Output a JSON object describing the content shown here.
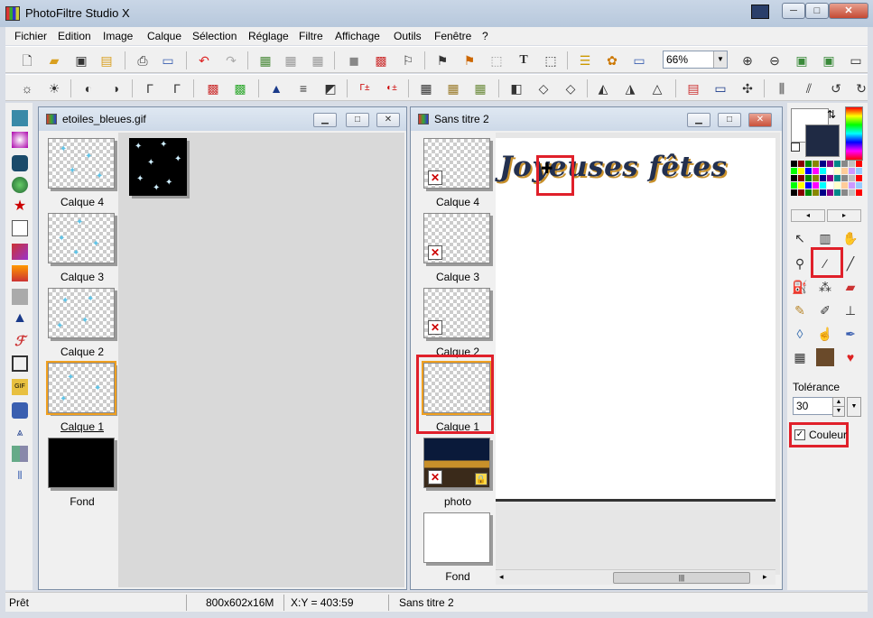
{
  "window": {
    "title": "PhotoFiltre Studio X",
    "controls": {
      "minimize": "─",
      "maximize": "□",
      "close": "✕"
    }
  },
  "menu": [
    "Fichier",
    "Edition",
    "Image",
    "Calque",
    "Sélection",
    "Réglage",
    "Filtre",
    "Affichage",
    "Outils",
    "Fenêtre",
    "?"
  ],
  "toolbar": {
    "zoom_value": "66%",
    "text_tool_glyph": "T"
  },
  "doc_left": {
    "title": "etoiles_bleues.gif",
    "layers": [
      {
        "label": "Calque 4"
      },
      {
        "label": "Calque 3"
      },
      {
        "label": "Calque 2"
      },
      {
        "label": "Calque 1",
        "selected": true
      },
      {
        "label": "Fond"
      }
    ]
  },
  "doc_right": {
    "title": "Sans titre 2",
    "canvas_text": "Joyeuses fêtes",
    "layers": [
      {
        "label": "Calque 4"
      },
      {
        "label": "Calque 3"
      },
      {
        "label": "Calque 2"
      },
      {
        "label": "Calque 1",
        "selected": true
      },
      {
        "label": "photo",
        "locked": true
      },
      {
        "label": "Fond"
      }
    ],
    "scroll_thumb_glyph": "|||"
  },
  "right_panel": {
    "tolerance_label": "Tolérance",
    "tolerance_value": "30",
    "couleur_label": "Couleur",
    "couleur_checked": true,
    "foreground_color": "#ffffff",
    "background_color": "#1f2a44"
  },
  "status": {
    "state": "Prêt",
    "dimensions": "800x602x16M",
    "coords": "X:Y = 403:59",
    "doc_name": "Sans titre 2"
  },
  "colors": {
    "accent_red": "#e0202a",
    "canvas_text_color": "#23304f",
    "star_blue": "#5fc4e8"
  }
}
